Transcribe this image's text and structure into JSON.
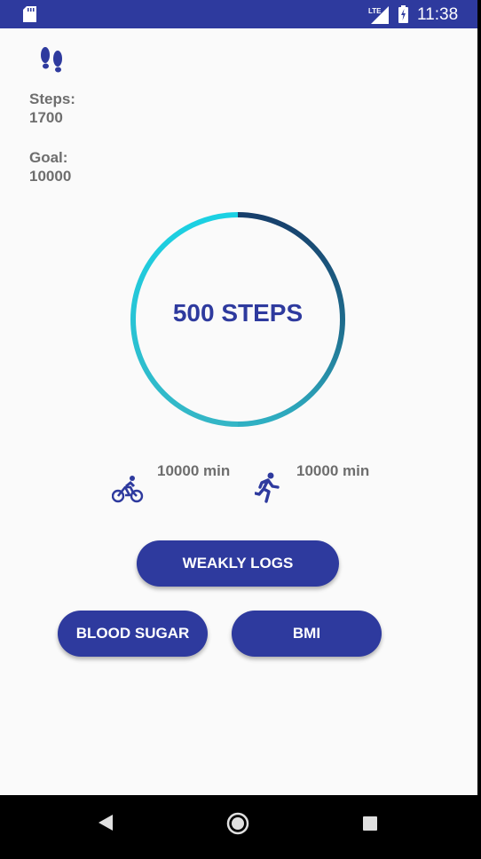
{
  "status_bar": {
    "time": "11:38",
    "network": "LTE",
    "background_color": "#2e3a9e"
  },
  "stats": {
    "steps_label": "Steps:",
    "steps_value": "1700",
    "goal_label": "Goal:",
    "goal_value": "10000"
  },
  "progress": {
    "label": "500 STEPS",
    "ring_start_color": "#1bd1e3",
    "ring_end_color": "#173f6b"
  },
  "activities": {
    "cycling_time": "10000 min",
    "running_time": "10000 min"
  },
  "buttons": {
    "weekly_logs": "WEAKLY LOGS",
    "blood_sugar": "BLOOD SUGAR",
    "bmi": "BMI"
  },
  "colors": {
    "primary": "#2e3a9e",
    "text_gray": "#6e6e6e",
    "background": "#fafafa"
  },
  "icons": [
    "sd-card-icon",
    "signal-icon",
    "battery-icon",
    "footprints-icon",
    "bicycle-icon",
    "running-icon",
    "back-icon",
    "home-icon",
    "recents-icon"
  ]
}
